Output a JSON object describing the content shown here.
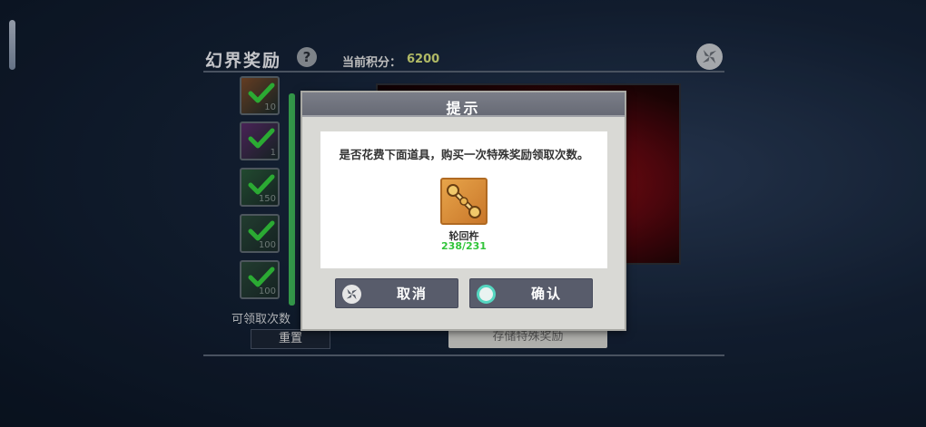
{
  "panel": {
    "title": "幻界奖励",
    "help_glyph": "?",
    "score_label": "当前积分：",
    "score_value": "6200",
    "claim_label": "可领取次数",
    "reset_label": "重置",
    "store_label": "存储特殊奖励",
    "progress_fraction": 1.0,
    "reward_slots": [
      {
        "count": "10",
        "claimed": true,
        "color": "#7a4a2a"
      },
      {
        "count": "1",
        "claimed": true,
        "color": "#5a2a6a"
      },
      {
        "count": "150",
        "claimed": true,
        "color": "#2a5a3a"
      },
      {
        "count": "100",
        "claimed": true,
        "color": "#2a4a3a"
      },
      {
        "count": "100",
        "claimed": true,
        "color": "#2a4a3a"
      }
    ]
  },
  "dialog": {
    "title": "提示",
    "message": "是否花费下面道具，购买一次特殊奖励领取次数。",
    "item_name": "轮回杵",
    "item_quantity": "238/231",
    "cancel_label": "取消",
    "confirm_label": "确认"
  },
  "colors": {
    "check": "#35d03f",
    "quantity_ok": "#31c43a",
    "score": "#d7e27c",
    "confirm_ring": "#55d6c0"
  }
}
